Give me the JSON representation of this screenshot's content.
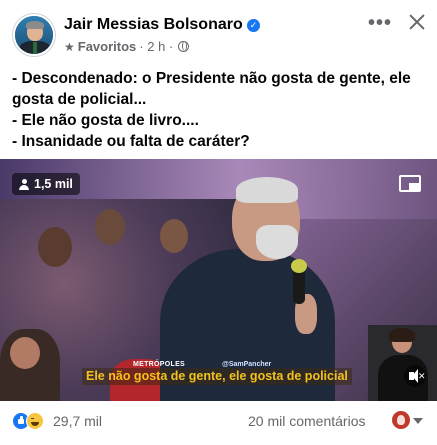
{
  "post": {
    "author": "Jair Messias Bolsonaro",
    "audience": "Favoritos",
    "time": "· 2 h ·",
    "text_lines": [
      "- Descondenado: o Presidente não gosta de gente, ele",
      "gosta de policial...",
      "- Ele não gosta de livro....",
      "- Insanidade ou falta de caráter?"
    ]
  },
  "video": {
    "viewers": "1,5 mil",
    "subtitle": "Ele não gosta de gente, ele gosta de policial",
    "watermark": "METRÓPOLES",
    "watermark_handle": "@SamPancher"
  },
  "footer": {
    "reactions_count": "29,7 mil",
    "comments_count": "20 mil comentários"
  },
  "icons": {
    "verified": "verified-badge-icon",
    "star": "star-icon",
    "globe": "globe-icon",
    "more": "more-options-icon",
    "close": "close-icon",
    "viewers": "person-icon",
    "pip": "picture-in-picture-icon",
    "mute": "mute-icon",
    "like": "like-reaction-icon",
    "haha": "haha-reaction-icon"
  },
  "colors": {
    "brand_blue": "#1877f2",
    "secondary_text": "#65676b",
    "subtitle_yellow": "#f3c21b"
  }
}
